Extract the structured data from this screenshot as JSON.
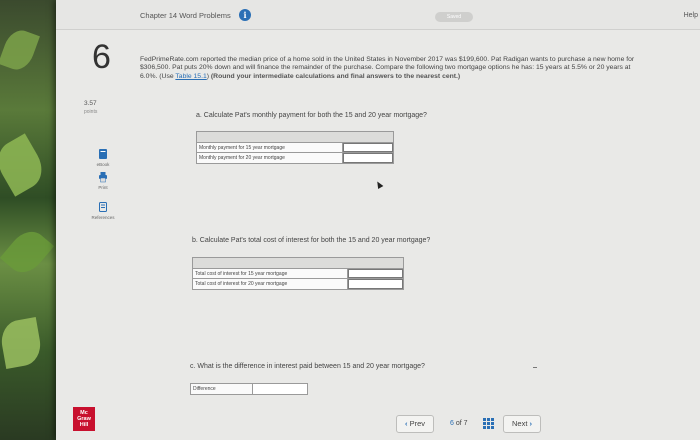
{
  "header": {
    "breadcrumb": "Chapter 14 Word Problems",
    "saved_label": "Saved",
    "help_label": "Help"
  },
  "question": {
    "number": "6",
    "points_value": "3.57",
    "points_label": "points",
    "prompt_main": "FedPrimeRate.com reported the median price of a home sold in the United States in November 2017 was $199,600. Pat Radigan wants to purchase a new home for $306,500. Pat puts 20% down and will finance the remainder of the purchase. Compare the following two mortgage options he has: 15 years at 5.5% or 20 years at 6.0%. (Use ",
    "table_link": "Table 15.1",
    "prompt_after_link": ") ",
    "prompt_bold": "(Round your intermediate calculations and final answers to the nearest cent.)"
  },
  "tools": [
    {
      "label": "eBook",
      "icon": "ebook-icon"
    },
    {
      "label": "Print",
      "icon": "print-icon"
    },
    {
      "label": "References",
      "icon": "references-icon"
    }
  ],
  "part_a": {
    "text": "a. Calculate Pat's monthly payment for both the 15 and 20 year mortgage?",
    "rows": [
      "Monthly payment for 15 year mortgage",
      "Monthly payment for 20 year mortgage"
    ]
  },
  "part_b": {
    "text": "b. Calculate Pat's total cost of interest for both the 15 and 20 year mortgage?",
    "rows": [
      "Total cost of interest for 15 year mortgage",
      "Total cost of interest for 20 year mortgage"
    ]
  },
  "part_c": {
    "text": "c. What is the difference in interest paid between 15 and 20 year mortgage?",
    "row_label": "Difference"
  },
  "footer": {
    "logo_lines": [
      "Mc",
      "Graw",
      "Hill"
    ],
    "prev_label": "Prev",
    "page_current": "6",
    "page_of": "of",
    "page_total": "7",
    "next_label": "Next"
  },
  "colors": {
    "accent": "#2a6fb5",
    "brand": "#c8102e"
  }
}
